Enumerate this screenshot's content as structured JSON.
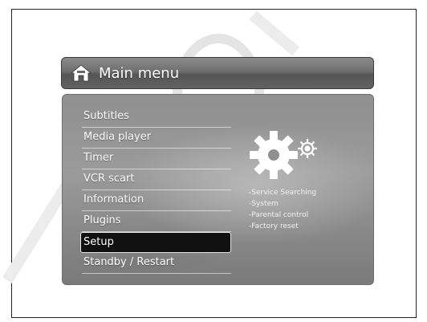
{
  "header": {
    "title": "Main menu",
    "icon": "home-icon"
  },
  "menu": {
    "items": [
      {
        "label": "Subtitles"
      },
      {
        "label": "Media player"
      },
      {
        "label": "Timer"
      },
      {
        "label": "VCR scart"
      },
      {
        "label": "Information"
      },
      {
        "label": "Plugins"
      },
      {
        "label": "Setup",
        "selected": true
      },
      {
        "label": "Standby / Restart"
      }
    ]
  },
  "detail": {
    "icon": "gears-icon",
    "items": [
      "-Service Searching",
      "-System",
      "-Parental control",
      "-Factory reset"
    ]
  }
}
